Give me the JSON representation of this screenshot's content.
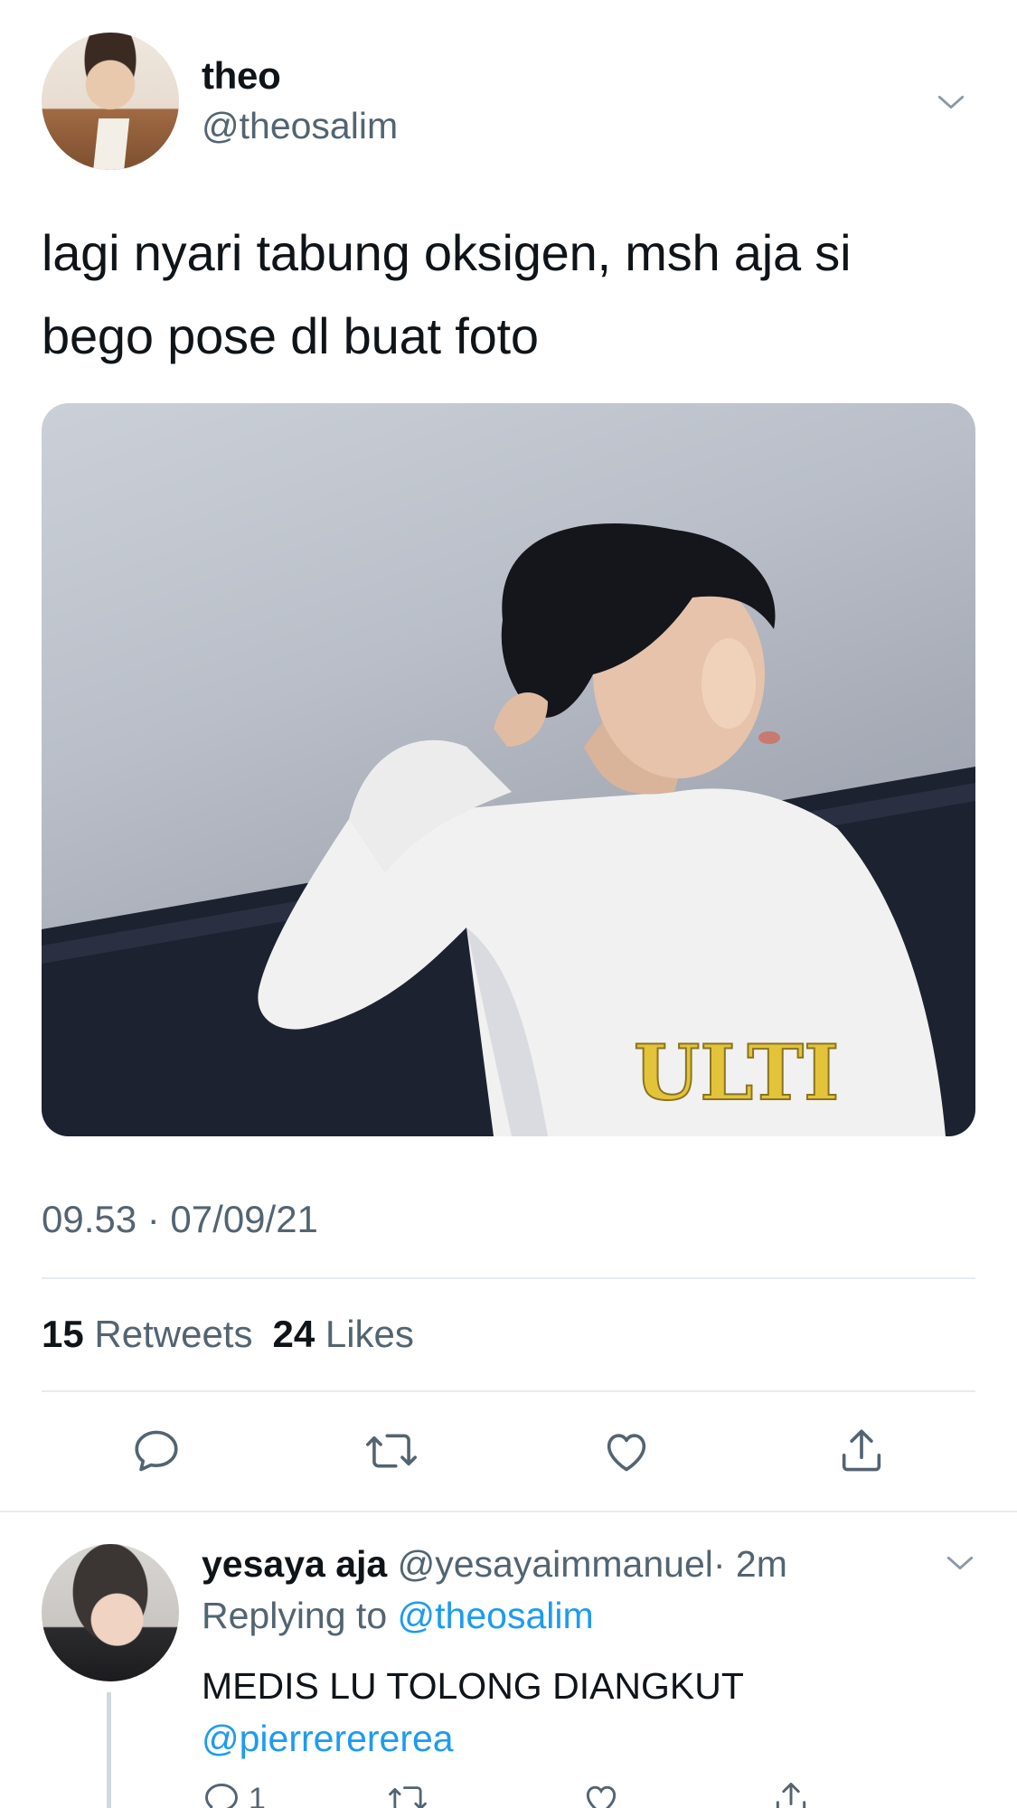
{
  "tweet": {
    "author_name": "theo",
    "author_handle": "@theosalim",
    "text_line1": "lagi nyari tabung oksigen, msh aja si",
    "text_line2": "bego pose dl buat foto",
    "timestamp": "09.53 · 07/09/21",
    "retweets_count": "15",
    "retweets_label": "Retweets",
    "likes_count": "24",
    "likes_label": "Likes",
    "media_shirt_text": "ULTI"
  },
  "actions": [
    {
      "icon": "reply-icon"
    },
    {
      "icon": "retweet-icon"
    },
    {
      "icon": "like-icon"
    },
    {
      "icon": "share-icon"
    }
  ],
  "reply": {
    "author_name": "yesaya aja",
    "author_handle": "@yesayaimmanuel",
    "time": "· 2m",
    "replying_prefix": "Replying to",
    "replying_handle": "@theosalim",
    "text": "MEDIS LU TOLONG DIANGKUT",
    "mention": "@pierrererereа",
    "reply_count": "1"
  },
  "colors": {
    "text": "#0f1419",
    "secondary": "#536471",
    "link": "#1d9bf0",
    "divider": "#e6ecf0"
  }
}
